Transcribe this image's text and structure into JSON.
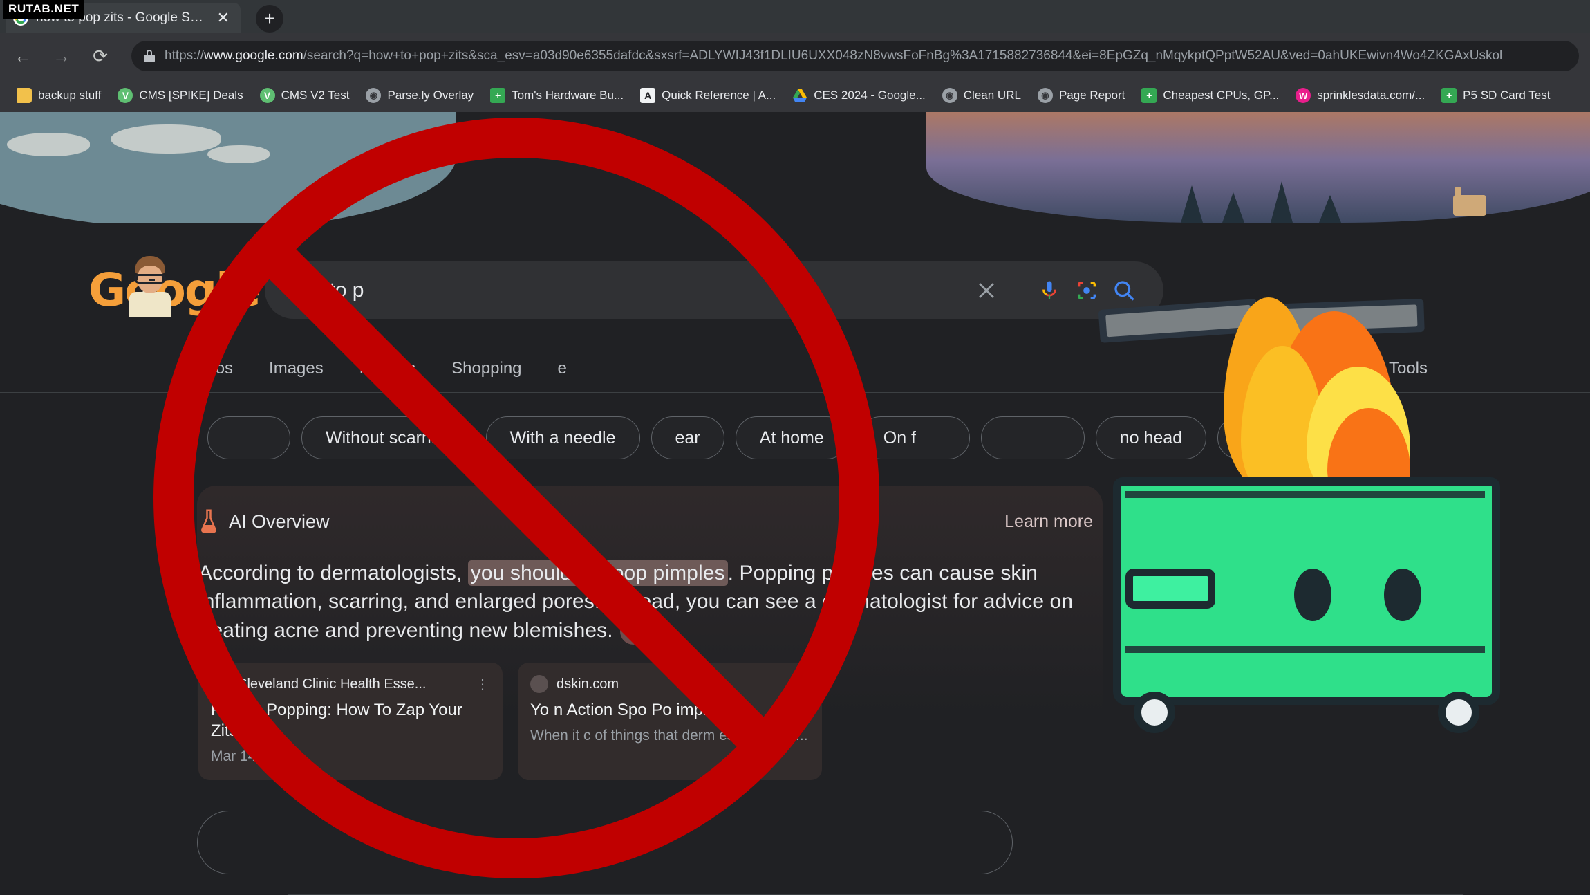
{
  "watermark": "RUTAB.NET",
  "browser": {
    "tab": {
      "title": "how to pop zits - Google Search",
      "favicon": "google-favicon",
      "close": "✕"
    },
    "new_tab": "+",
    "nav": {
      "back": "←",
      "forward": "→",
      "reload": "⟳"
    },
    "omnibox": {
      "scheme": "https://",
      "host": "www.google.com",
      "path": "/search?q=how+to+pop+zits&sca_esv=a03d90e6355dafdc&sxsrf=ADLYWIJ43f1DLIU6UXX048zN8vwsFoFnBg%3A1715882736844&ei=8EpGZq_nMqykptQPptW52AU&ved=0ahUKEwivn4Wo4ZKGAxUskol",
      "lock": "lock-icon"
    },
    "bookmarks": [
      {
        "label": "backup stuff",
        "icon": "folder-icon",
        "color": "#f2c14b"
      },
      {
        "label": "CMS [SPIKE] Deals",
        "icon": "v-circle-icon",
        "color": "#5fbf72"
      },
      {
        "label": "CMS V2 Test",
        "icon": "v-circle-icon",
        "color": "#5fbf72"
      },
      {
        "label": "Parse.ly Overlay",
        "icon": "globe-icon",
        "color": "#9aa0a6"
      },
      {
        "label": "Tom's Hardware Bu...",
        "icon": "sheets-icon",
        "color": "#34a853"
      },
      {
        "label": "Quick Reference | A...",
        "icon": "letter-a-icon",
        "color": "#f1f3f4"
      },
      {
        "label": "CES 2024 - Google...",
        "icon": "drive-icon",
        "color": "#fbbc04"
      },
      {
        "label": "Clean URL",
        "icon": "globe-icon",
        "color": "#9aa0a6"
      },
      {
        "label": "Page Report",
        "icon": "globe-icon",
        "color": "#9aa0a6"
      },
      {
        "label": "Cheapest CPUs, GP...",
        "icon": "sheets-icon",
        "color": "#34a853"
      },
      {
        "label": "sprinklesdata.com/...",
        "icon": "w-circle-icon",
        "color": "#e91e8c"
      },
      {
        "label": "P5 SD Card Test",
        "icon": "sheets-icon",
        "color": "#34a853"
      }
    ]
  },
  "google": {
    "logo": "Google",
    "doodle": "google-doodle-fish-scene",
    "search": {
      "value": "how to p",
      "placeholder": "Search",
      "clear_icon": "close-icon",
      "mic_icon": "microphone-icon",
      "lens_icon": "google-lens-icon",
      "search_icon": "search-icon"
    },
    "nav_tabs": [
      "deos",
      "Images",
      "Forums",
      "Shopping",
      "e"
    ],
    "tools_label": "Tools",
    "chips": [
      "",
      "Without scarring",
      "With a needle",
      " ear",
      "At home",
      "On f",
      "",
      "no head",
      "On back"
    ],
    "ai_overview": {
      "title": "AI Overview",
      "icon": "flask-icon",
      "learn_more": "Learn more",
      "text_before": "According to dermatologists, ",
      "highlight": "you should not pop pimples",
      "text_after": ". Popping pimples can cause skin inflammation, scarring, and enlarged pores. Instead, you can see a dermatologist for advice on treating acne and preventing new blemishes.",
      "collapse_icon": "chevron-up-icon",
      "cards": [
        {
          "source": "Cleveland Clinic Health Esse...",
          "favicon": "cleveland-clinic-favicon",
          "title": "Pimple Popping: How To Zap Your Zits",
          "meta": "Mar 14, 2022",
          "snippet": "",
          "kebab": "⋮"
        },
        {
          "source": "dskin.com",
          "favicon": "dskin-favicon",
          "title": "Yo n Action Spo Po imple",
          "meta": "",
          "snippet": "When it c of things that derm estheticians...",
          "kebab": "⋮"
        }
      ]
    },
    "show_more": {
      "label": "more",
      "icon": "chevron-down-icon"
    }
  },
  "overlays": {
    "prohibition_sign": {
      "name": "no-entry-overlay",
      "color": "#c00000"
    },
    "dumpster_fire": {
      "name": "dumpster-fire-overlay",
      "bin_color": "#2fe08a",
      "outline_color": "#1d2a30"
    }
  }
}
